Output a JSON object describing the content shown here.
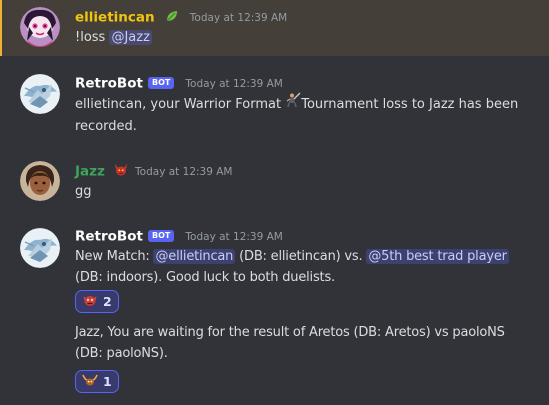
{
  "messages": {
    "m1": {
      "username": "ellietincan",
      "timestamp": "Today at 12:39 AM",
      "text_prefix": "!loss",
      "mention": "@Jazz"
    },
    "m2": {
      "username": "RetroBot",
      "bot_tag": "BOT",
      "timestamp": "Today at 12:39 AM",
      "text_line1": "ellietincan, your Warrior Format",
      "text_line1b": "Tournament loss to Jazz has been",
      "text_line2": "recorded."
    },
    "m3": {
      "username": "Jazz",
      "timestamp": "Today at 12:39 AM",
      "text": "gg"
    },
    "m4": {
      "username": "RetroBot",
      "bot_tag": "BOT",
      "timestamp": "Today at 12:39 AM",
      "t1": "New Match:",
      "mention1": "@ellietincan",
      "t2": "(DB: ellietincan) vs.",
      "mention2": "@5th best trad player",
      "t3": "(DB: indoors). Good luck to both duelists.",
      "reaction_count": "2"
    },
    "m5": {
      "text_line1": "Jazz, You are waiting for the result of Aretos (DB: Aretos) vs paoloNS",
      "text_line2": "(DB: paoloNS).",
      "reaction_count": "1"
    }
  },
  "colors": {
    "background": "#313338",
    "highlight_bg": "#444039",
    "highlight_border": "#f0b232",
    "ellietincan_name": "#f1c40f",
    "retrobot_name": "#ffffff",
    "jazz_name": "#3ba55c",
    "bot_tag": "#5865f2",
    "mention_bg": "#3c4270",
    "timestamp": "#949ba4"
  },
  "icons": {
    "ellietincan_badge": "leaf-icon",
    "jazz_badge": "red-creature-icon",
    "format_emoji": "warrior-icon",
    "reaction1": "red-monster-emoji",
    "reaction2": "horned-creature-emoji"
  }
}
